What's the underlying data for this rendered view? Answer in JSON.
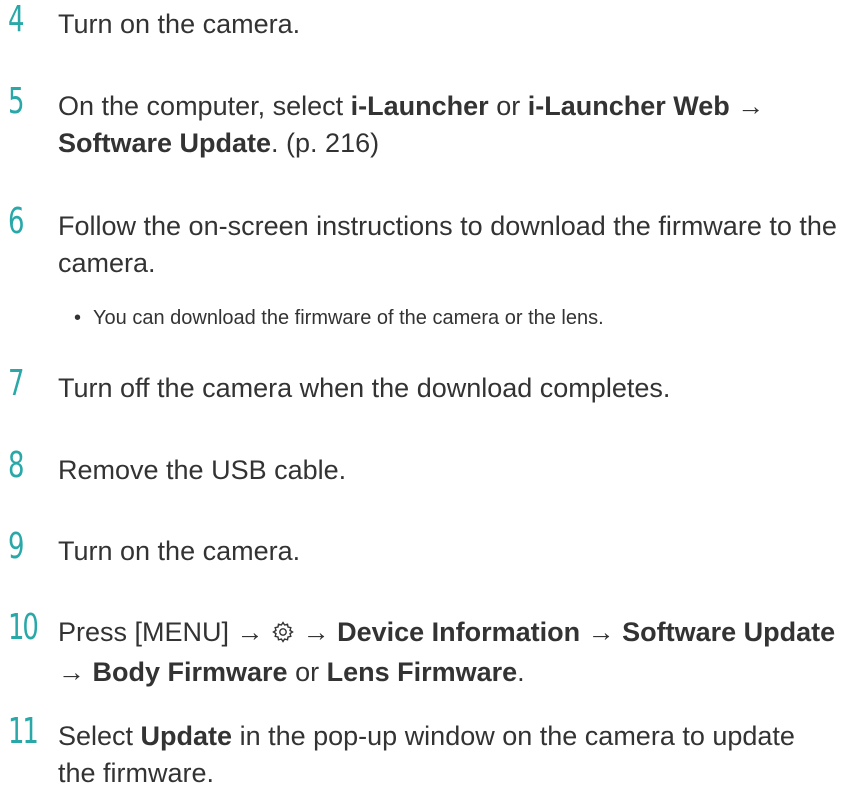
{
  "steps": [
    {
      "number": "4",
      "text": "Turn on the camera."
    },
    {
      "number": "5",
      "pre": "On the computer, select ",
      "b1": "i-Launcher",
      "mid": " or ",
      "b2": "i-Launcher Web",
      "arrow": " → ",
      "b3": "Software Update",
      "post": ". (p. 216)"
    },
    {
      "number": "6",
      "text": "Follow the on-screen instructions to download the firmware to the camera.",
      "bullet": "You can download the firmware of the camera or the lens."
    },
    {
      "number": "7",
      "text": "Turn off the camera when the download completes."
    },
    {
      "number": "8",
      "text": "Remove the USB cable."
    },
    {
      "number": "9",
      "text": "Turn on the camera."
    },
    {
      "number": "10",
      "pre": "Press [",
      "menu": "MENU",
      "close": "]",
      "arrow": " → ",
      "b1": "Device Information",
      "b2": "Software Update",
      "b3": "Body Firmware",
      "or": " or ",
      "b4": "Lens Firmware",
      "post": "."
    },
    {
      "number": "11",
      "pre": "Select ",
      "b1": "Update",
      "post": " in the pop-up window on the camera to update the firmware."
    }
  ],
  "bullet_symbol": "•",
  "icon": "gear-icon"
}
